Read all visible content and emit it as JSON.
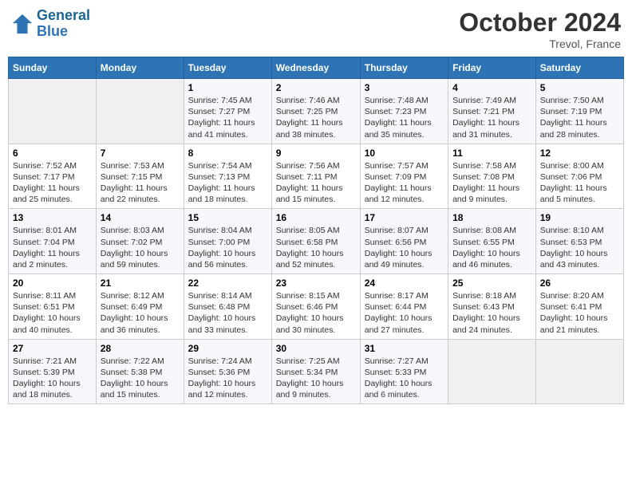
{
  "header": {
    "logo_line1": "General",
    "logo_line2": "Blue",
    "month": "October 2024",
    "location": "Trevol, France"
  },
  "weekdays": [
    "Sunday",
    "Monday",
    "Tuesday",
    "Wednesday",
    "Thursday",
    "Friday",
    "Saturday"
  ],
  "weeks": [
    [
      {
        "day": "",
        "info": ""
      },
      {
        "day": "",
        "info": ""
      },
      {
        "day": "1",
        "info": "Sunrise: 7:45 AM\nSunset: 7:27 PM\nDaylight: 11 hours and 41 minutes."
      },
      {
        "day": "2",
        "info": "Sunrise: 7:46 AM\nSunset: 7:25 PM\nDaylight: 11 hours and 38 minutes."
      },
      {
        "day": "3",
        "info": "Sunrise: 7:48 AM\nSunset: 7:23 PM\nDaylight: 11 hours and 35 minutes."
      },
      {
        "day": "4",
        "info": "Sunrise: 7:49 AM\nSunset: 7:21 PM\nDaylight: 11 hours and 31 minutes."
      },
      {
        "day": "5",
        "info": "Sunrise: 7:50 AM\nSunset: 7:19 PM\nDaylight: 11 hours and 28 minutes."
      }
    ],
    [
      {
        "day": "6",
        "info": "Sunrise: 7:52 AM\nSunset: 7:17 PM\nDaylight: 11 hours and 25 minutes."
      },
      {
        "day": "7",
        "info": "Sunrise: 7:53 AM\nSunset: 7:15 PM\nDaylight: 11 hours and 22 minutes."
      },
      {
        "day": "8",
        "info": "Sunrise: 7:54 AM\nSunset: 7:13 PM\nDaylight: 11 hours and 18 minutes."
      },
      {
        "day": "9",
        "info": "Sunrise: 7:56 AM\nSunset: 7:11 PM\nDaylight: 11 hours and 15 minutes."
      },
      {
        "day": "10",
        "info": "Sunrise: 7:57 AM\nSunset: 7:09 PM\nDaylight: 11 hours and 12 minutes."
      },
      {
        "day": "11",
        "info": "Sunrise: 7:58 AM\nSunset: 7:08 PM\nDaylight: 11 hours and 9 minutes."
      },
      {
        "day": "12",
        "info": "Sunrise: 8:00 AM\nSunset: 7:06 PM\nDaylight: 11 hours and 5 minutes."
      }
    ],
    [
      {
        "day": "13",
        "info": "Sunrise: 8:01 AM\nSunset: 7:04 PM\nDaylight: 11 hours and 2 minutes."
      },
      {
        "day": "14",
        "info": "Sunrise: 8:03 AM\nSunset: 7:02 PM\nDaylight: 10 hours and 59 minutes."
      },
      {
        "day": "15",
        "info": "Sunrise: 8:04 AM\nSunset: 7:00 PM\nDaylight: 10 hours and 56 minutes."
      },
      {
        "day": "16",
        "info": "Sunrise: 8:05 AM\nSunset: 6:58 PM\nDaylight: 10 hours and 52 minutes."
      },
      {
        "day": "17",
        "info": "Sunrise: 8:07 AM\nSunset: 6:56 PM\nDaylight: 10 hours and 49 minutes."
      },
      {
        "day": "18",
        "info": "Sunrise: 8:08 AM\nSunset: 6:55 PM\nDaylight: 10 hours and 46 minutes."
      },
      {
        "day": "19",
        "info": "Sunrise: 8:10 AM\nSunset: 6:53 PM\nDaylight: 10 hours and 43 minutes."
      }
    ],
    [
      {
        "day": "20",
        "info": "Sunrise: 8:11 AM\nSunset: 6:51 PM\nDaylight: 10 hours and 40 minutes."
      },
      {
        "day": "21",
        "info": "Sunrise: 8:12 AM\nSunset: 6:49 PM\nDaylight: 10 hours and 36 minutes."
      },
      {
        "day": "22",
        "info": "Sunrise: 8:14 AM\nSunset: 6:48 PM\nDaylight: 10 hours and 33 minutes."
      },
      {
        "day": "23",
        "info": "Sunrise: 8:15 AM\nSunset: 6:46 PM\nDaylight: 10 hours and 30 minutes."
      },
      {
        "day": "24",
        "info": "Sunrise: 8:17 AM\nSunset: 6:44 PM\nDaylight: 10 hours and 27 minutes."
      },
      {
        "day": "25",
        "info": "Sunrise: 8:18 AM\nSunset: 6:43 PM\nDaylight: 10 hours and 24 minutes."
      },
      {
        "day": "26",
        "info": "Sunrise: 8:20 AM\nSunset: 6:41 PM\nDaylight: 10 hours and 21 minutes."
      }
    ],
    [
      {
        "day": "27",
        "info": "Sunrise: 7:21 AM\nSunset: 5:39 PM\nDaylight: 10 hours and 18 minutes."
      },
      {
        "day": "28",
        "info": "Sunrise: 7:22 AM\nSunset: 5:38 PM\nDaylight: 10 hours and 15 minutes."
      },
      {
        "day": "29",
        "info": "Sunrise: 7:24 AM\nSunset: 5:36 PM\nDaylight: 10 hours and 12 minutes."
      },
      {
        "day": "30",
        "info": "Sunrise: 7:25 AM\nSunset: 5:34 PM\nDaylight: 10 hours and 9 minutes."
      },
      {
        "day": "31",
        "info": "Sunrise: 7:27 AM\nSunset: 5:33 PM\nDaylight: 10 hours and 6 minutes."
      },
      {
        "day": "",
        "info": ""
      },
      {
        "day": "",
        "info": ""
      }
    ]
  ]
}
